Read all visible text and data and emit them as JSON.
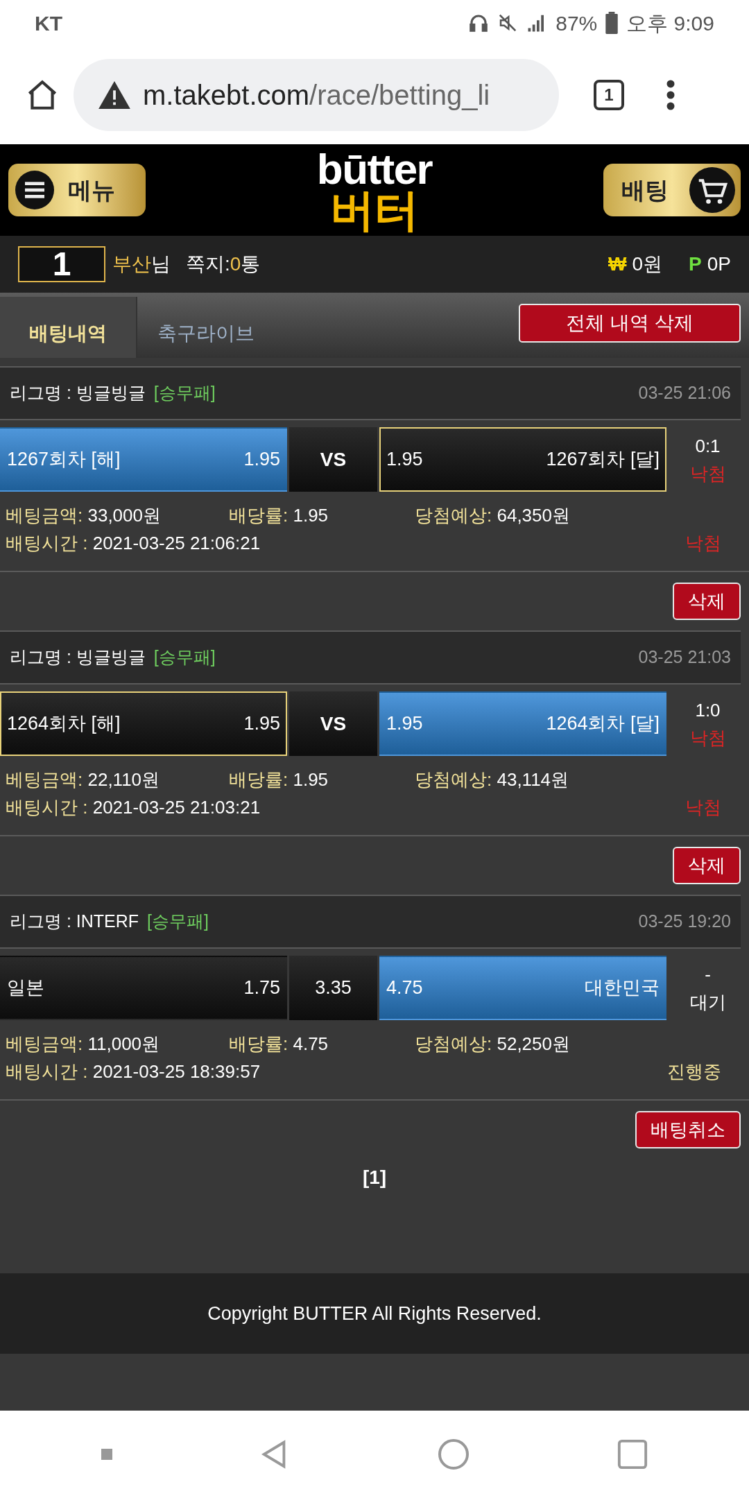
{
  "status_bar": {
    "carrier": "KT",
    "battery": "87%",
    "time": "오후 9:09"
  },
  "browser": {
    "url_host": "m.takebt.com",
    "url_path": "/race/betting_li",
    "tab_count": "1"
  },
  "header": {
    "menu": "메뉴",
    "logo_top": "būtter",
    "logo_bottom": "버터",
    "bet": "배팅"
  },
  "user_bar": {
    "rank": "1",
    "name": "부산",
    "name_suffix": "님",
    "memo_label": "쪽지:",
    "memo_count": "0",
    "memo_unit": "통",
    "won_symbol": "₩",
    "money": "0원",
    "point_symbol": "P",
    "points": "0P"
  },
  "tabs": [
    {
      "label": "배팅내역",
      "selected": true
    },
    {
      "label": "축구라이브",
      "selected": false
    }
  ],
  "delete_all": "전체 내역 삭제",
  "bets": [
    {
      "league": "리그명 : 빙글빙글",
      "market": "[승무패]",
      "time": "03-25 21:06",
      "home": {
        "name": "1267회차 [해]",
        "odds": "1.95",
        "selected": true,
        "outlined": false
      },
      "middle": {
        "kind": "vs",
        "text": "VS"
      },
      "away": {
        "name": "1267회차 [달]",
        "odds": "1.95",
        "selected": false,
        "outlined": true
      },
      "score": "0:1",
      "result": {
        "text": "낙첨",
        "kind": "lost"
      },
      "amount_label": "베팅금액:",
      "amount": "33,000원",
      "rate_label": "배당률:",
      "rate": "1.95",
      "expected_label": "당첨예상:",
      "expected": "64,350원",
      "bet_time_label": "배팅시간 :",
      "bet_time": "2021-03-25 21:06:21",
      "status": {
        "text": "낙첨",
        "kind": "lost"
      },
      "action": "삭제"
    },
    {
      "league": "리그명 : 빙글빙글",
      "market": "[승무패]",
      "time": "03-25 21:03",
      "home": {
        "name": "1264회차 [해]",
        "odds": "1.95",
        "selected": false,
        "outlined": true
      },
      "middle": {
        "kind": "vs",
        "text": "VS"
      },
      "away": {
        "name": "1264회차 [달]",
        "odds": "1.95",
        "selected": true,
        "outlined": false
      },
      "score": "1:0",
      "result": {
        "text": "낙첨",
        "kind": "lost"
      },
      "amount_label": "베팅금액:",
      "amount": "22,110원",
      "rate_label": "배당률:",
      "rate": "1.95",
      "expected_label": "당첨예상:",
      "expected": "43,114원",
      "bet_time_label": "배팅시간 :",
      "bet_time": "2021-03-25 21:03:21",
      "status": {
        "text": "낙첨",
        "kind": "lost"
      },
      "action": "삭제"
    },
    {
      "league": "리그명 : INTERF",
      "market": "[승무패]",
      "time": "03-25 19:20",
      "home": {
        "name": "일본",
        "odds": "1.75",
        "selected": false,
        "outlined": false
      },
      "middle": {
        "kind": "odds",
        "text": "3.35"
      },
      "away": {
        "name": "대한민국",
        "odds": "4.75",
        "selected": true,
        "outlined": false
      },
      "score": "-",
      "result": {
        "text": "대기",
        "kind": "pending"
      },
      "amount_label": "베팅금액:",
      "amount": "11,000원",
      "rate_label": "배당률:",
      "rate": "4.75",
      "expected_label": "당첨예상:",
      "expected": "52,250원",
      "bet_time_label": "배팅시간 :",
      "bet_time": "2021-03-25 18:39:57",
      "status": {
        "text": "진행중",
        "kind": "progress"
      },
      "action": "배팅취소"
    }
  ],
  "pagination": "[1]",
  "footer": "Copyright BUTTER All Rights Reserved."
}
